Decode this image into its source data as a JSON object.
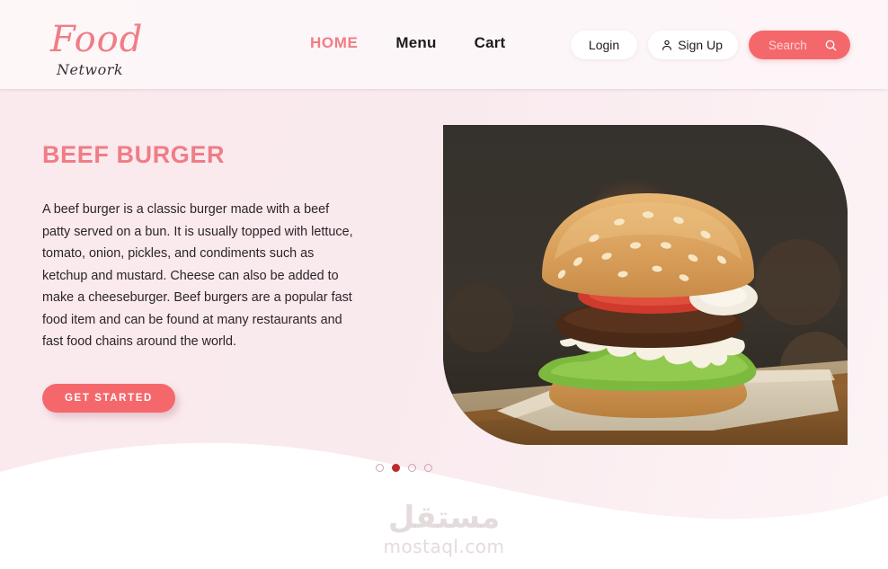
{
  "brand": {
    "name": "Food",
    "tagline": "Network"
  },
  "nav": {
    "items": [
      {
        "label": "HOME",
        "active": true
      },
      {
        "label": "Menu",
        "active": false
      },
      {
        "label": "Cart",
        "active": false
      }
    ]
  },
  "actions": {
    "login_label": "Login",
    "signup_label": "Sign Up",
    "signup_icon": "user-icon",
    "search_placeholder": "Search",
    "search_icon": "search-icon"
  },
  "hero": {
    "title": "BEEF BURGER",
    "description": "A beef burger is a classic burger made with a beef patty served on a bun. It is usually topped with lettuce, tomato, onion, pickles, and condiments such as ketchup and mustard. Cheese can also be added to make a cheeseburger. Beef burgers are a popular fast food item and can be found at many restaurants and fast food chains around the world.",
    "cta_label": "GET  STARTED",
    "image_alt": "beef burger on parchment paper"
  },
  "carousel": {
    "total": 4,
    "active_index": 1
  },
  "watermark": {
    "arabic": "مستقل",
    "latin": "mostaql.com"
  },
  "colors": {
    "accent": "#f4686c",
    "accent_soft": "#ef7d86",
    "hero_bg": "#f9eaee",
    "header_bg": "#fdf6f8",
    "text_dark": "#1f1b1d",
    "dot_active": "#c0282f"
  }
}
